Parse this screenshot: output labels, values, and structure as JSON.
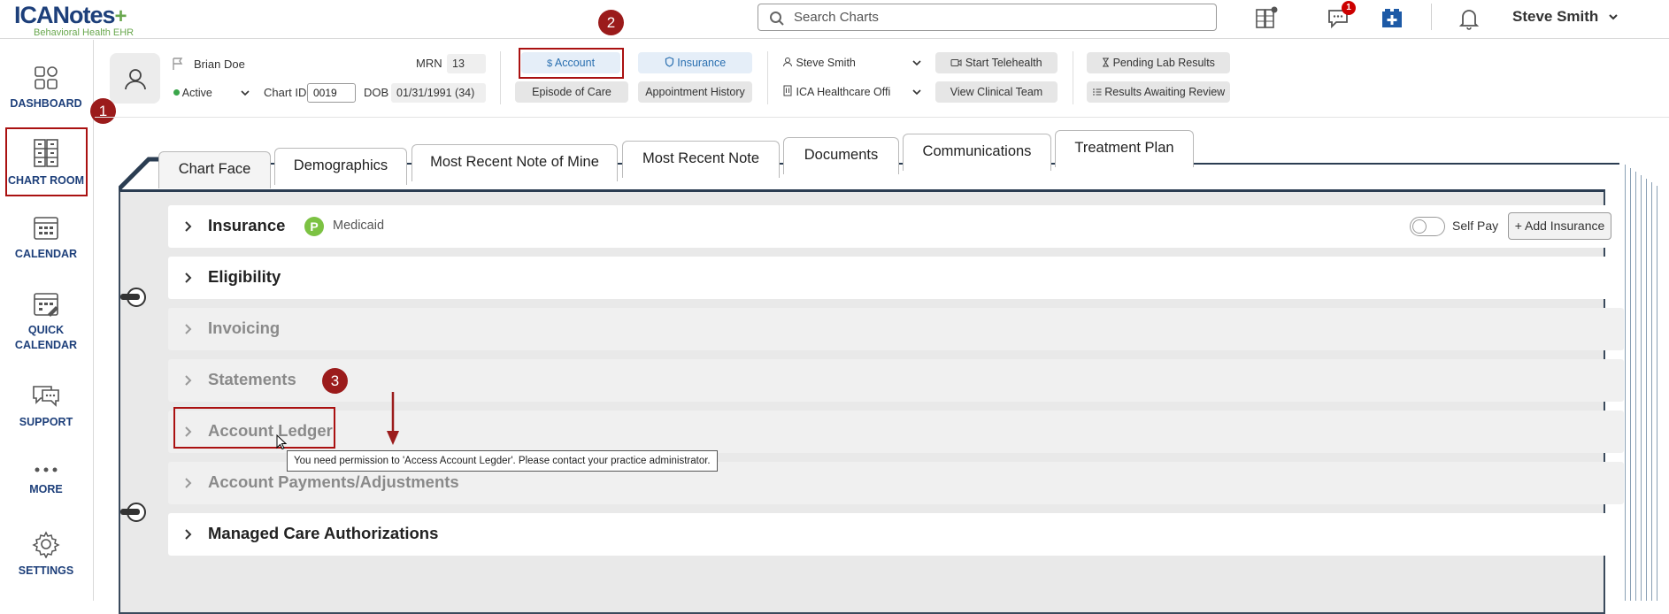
{
  "app": {
    "logo_main": "ICANotes",
    "logo_plus": "+",
    "logo_sub": "Behavioral Health EHR"
  },
  "topbar": {
    "search_placeholder": "Search Charts",
    "messages_badge": "1",
    "user_name": "Steve Smith"
  },
  "nav": {
    "dashboard": "DASHBOARD",
    "chart_room": "CHART ROOM",
    "calendar": "CALENDAR",
    "quick_calendar_1": "QUICK",
    "quick_calendar_2": "CALENDAR",
    "support": "SUPPORT",
    "more": "MORE",
    "settings": "SETTINGS"
  },
  "steps": {
    "one": "1",
    "two": "2",
    "three": "3"
  },
  "patient": {
    "name": "Brian Doe",
    "status": "Active",
    "mrn_label": "MRN",
    "mrn": "13",
    "chart_id_label": "Chart ID",
    "chart_id": "0019",
    "dob_label": "DOB",
    "dob": "01/31/1991 (34)"
  },
  "actions": {
    "account": "Account",
    "insurance": "Insurance",
    "episode_of_care": "Episode of Care",
    "appointment_history": "Appointment History",
    "provider": "Steve Smith",
    "office": "ICA Healthcare Offi",
    "start_telehealth": "Start Telehealth",
    "view_clinical_team": "View Clinical Team",
    "pending_lab_results": "Pending Lab Results",
    "results_awaiting_review": "Results Awaiting Review"
  },
  "tabs": [
    {
      "label": "Chart Face",
      "active": true
    },
    {
      "label": "Demographics"
    },
    {
      "label": "Most Recent Note of Mine"
    },
    {
      "label": "Most Recent Note"
    },
    {
      "label": "Documents"
    },
    {
      "label": "Communications"
    },
    {
      "label": "Treatment Plan"
    }
  ],
  "sections": {
    "insurance": "Insurance",
    "insurance_badge": "P",
    "insurance_plan": "Medicaid",
    "self_pay": "Self Pay",
    "add_insurance": "+ Add Insurance",
    "eligibility": "Eligibility",
    "invoicing": "Invoicing",
    "statements": "Statements",
    "account_ledger": "Account Ledger",
    "account_payments": "Account Payments/Adjustments",
    "managed_care": "Managed Care Authorizations"
  },
  "tooltip": "You need permission to 'Access Account Legder'. Please contact your practice administrator.",
  "colors": {
    "brand_navy": "#1d3f7a",
    "brand_green": "#6aa84f",
    "highlight_red": "#a11111",
    "step_red": "#9b1b1b",
    "link_blue": "#2a6fb0"
  }
}
